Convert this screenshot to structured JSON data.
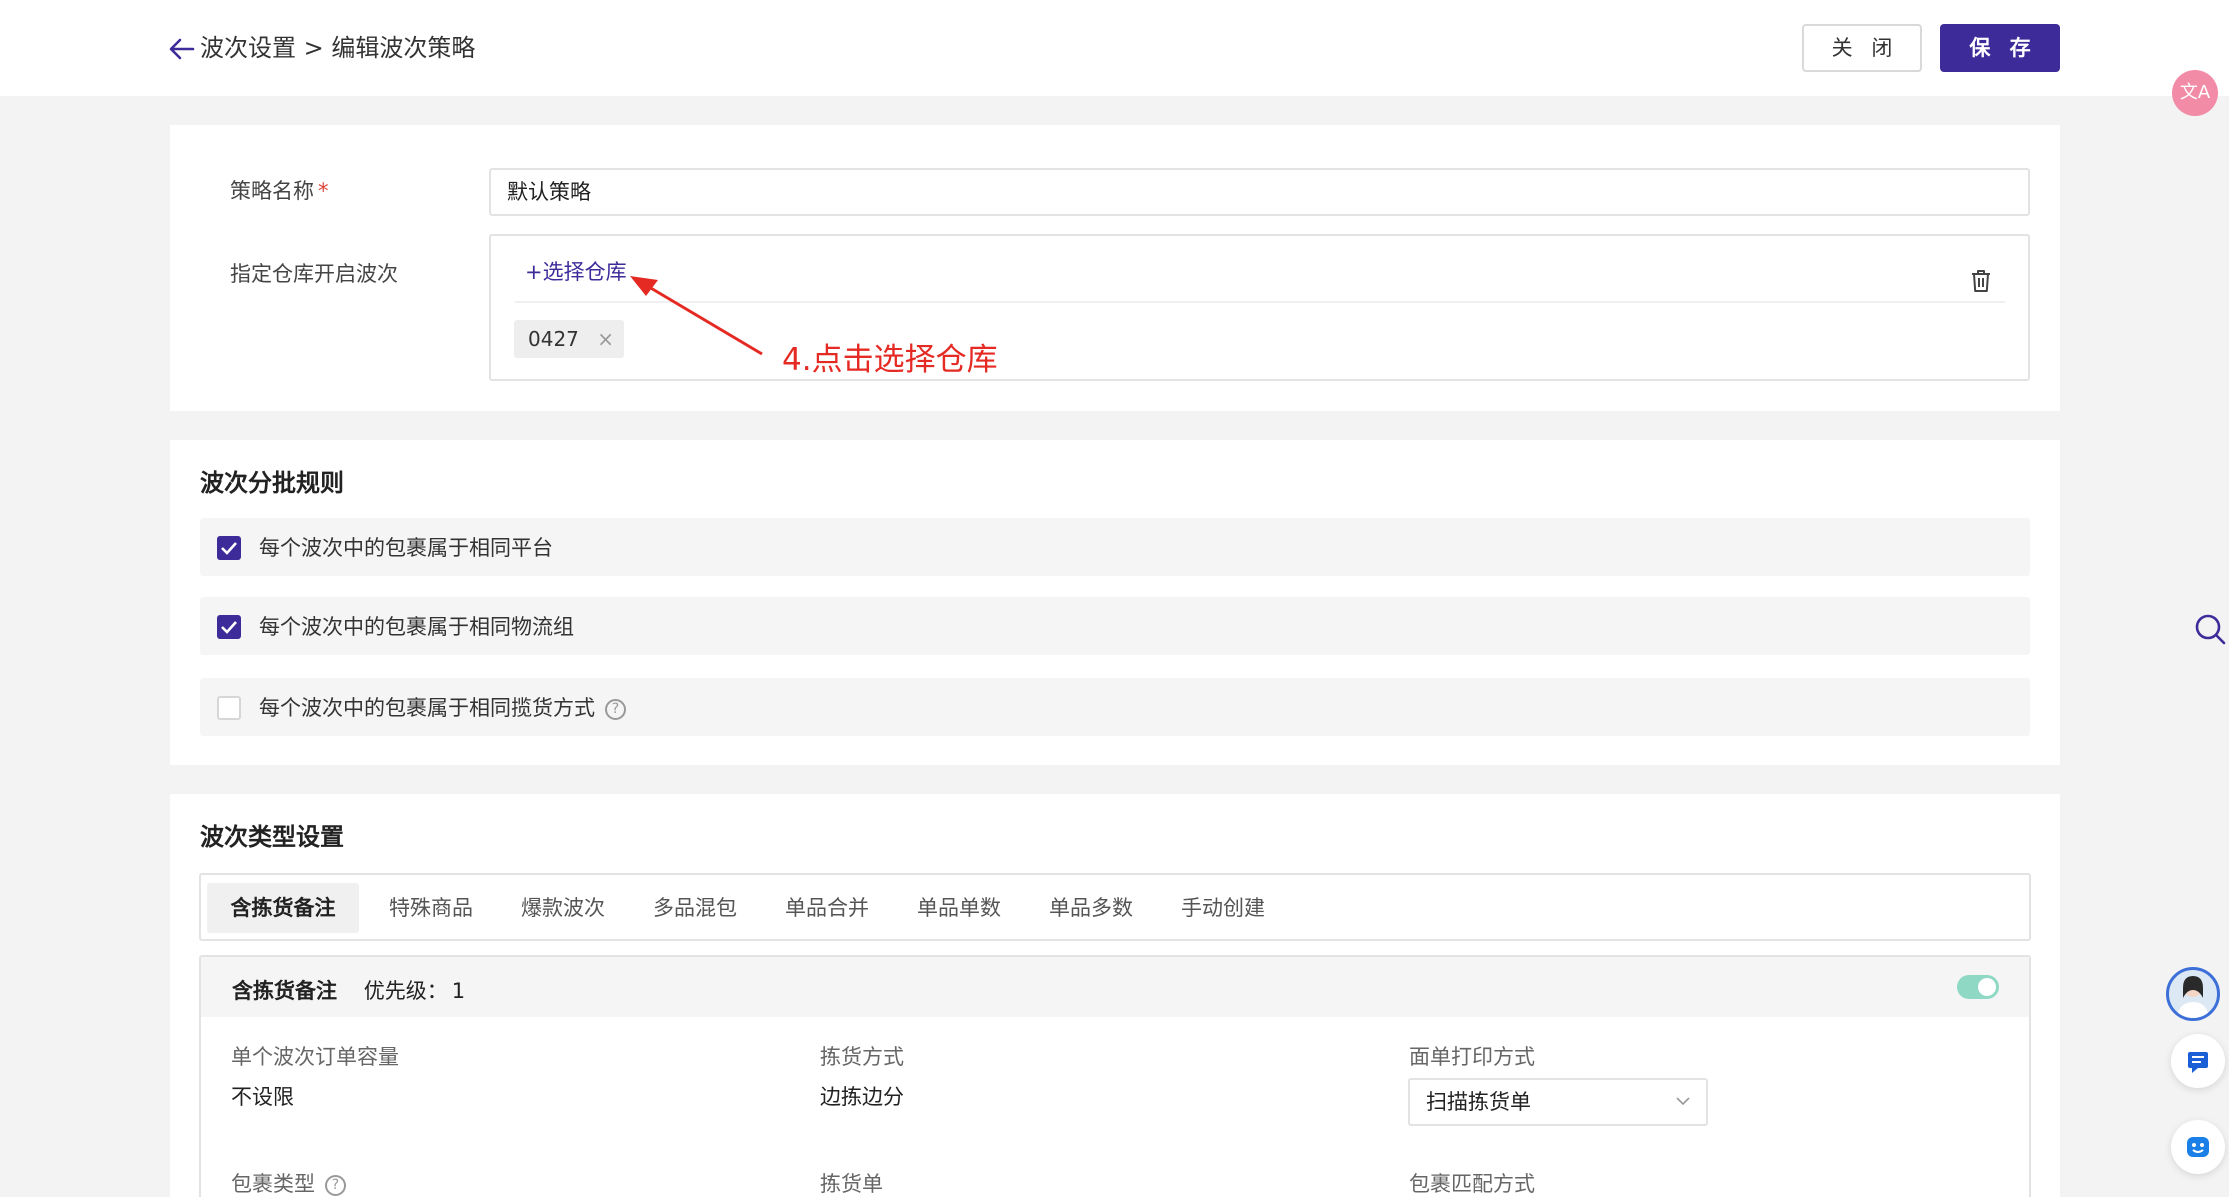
{
  "header": {
    "breadcrumb": "波次设置 > 编辑波次策略",
    "close_label": "关 闭",
    "save_label": "保 存"
  },
  "strategy": {
    "name_label": "策略名称",
    "required_mark": "*",
    "name_value": "默认策略",
    "warehouse_label": "指定仓库开启波次",
    "select_warehouse": "+选择仓库",
    "warehouse_tags": [
      "0427"
    ],
    "annotation": "4.点击选择仓库"
  },
  "batch_rules": {
    "title": "波次分批规则",
    "items": [
      {
        "label": "每个波次中的包裹属于相同平台",
        "checked": true
      },
      {
        "label": "每个波次中的包裹属于相同物流组",
        "checked": true
      },
      {
        "label": "每个波次中的包裹属于相同揽货方式",
        "checked": false
      }
    ]
  },
  "type_settings": {
    "title": "波次类型设置",
    "tabs": [
      "含拣货备注",
      "特殊商品",
      "爆款波次",
      "多品混包",
      "单品合并",
      "单品单数",
      "单品多数",
      "手动创建"
    ],
    "active_tab": 0,
    "card": {
      "name": "含拣货备注",
      "priority_label": "优先级：",
      "priority_value": "1",
      "enabled": true,
      "fields": {
        "capacity_label": "单个波次订单容量",
        "capacity_value": "不设限",
        "pick_method_label": "拣货方式",
        "pick_method_value": "边拣边分",
        "print_label": "面单打印方式",
        "print_value": "扫描拣货单",
        "package_type_label": "包裹类型",
        "pick_list_label": "拣货单",
        "match_label": "包裹匹配方式"
      }
    }
  },
  "colors": {
    "primary": "#3d2b9a",
    "annotation": "#e52a24",
    "toggle_on": "#8fd8c3"
  }
}
